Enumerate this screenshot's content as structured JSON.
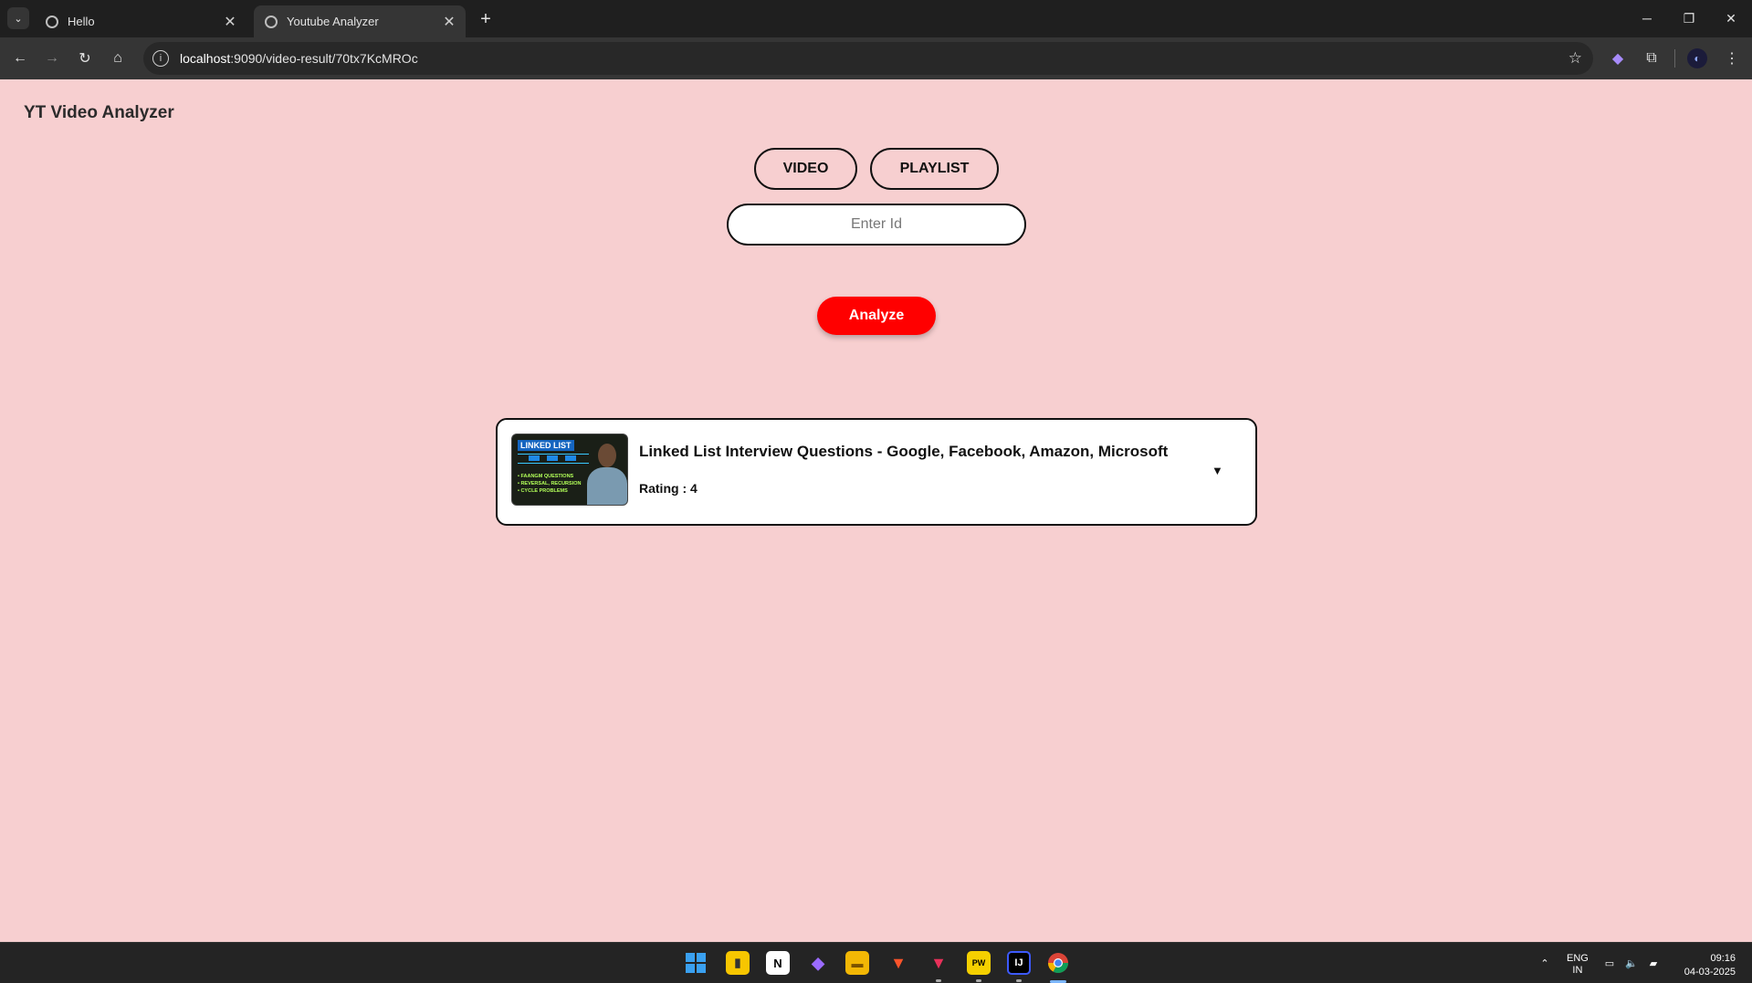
{
  "browser": {
    "tabs": [
      {
        "title": "Hello",
        "active": false
      },
      {
        "title": "Youtube Analyzer",
        "active": true
      }
    ],
    "url_host": "localhost",
    "url_rest": ":9090/video-result/70tx7KcMROc"
  },
  "app": {
    "title": "YT Video Analyzer",
    "mode_buttons": {
      "video": "VIDEO",
      "playlist": "PLAYLIST"
    },
    "id_input": {
      "value": "",
      "placeholder": "Enter Id"
    },
    "analyze_label": "Analyze"
  },
  "result": {
    "thumbnail": {
      "title": "LINKED LIST",
      "bullets": [
        "• FAANGM QUESTIONS",
        "• REVERSAL, RECURSION",
        "• CYCLE PROBLEMS"
      ]
    },
    "video_title": "Linked List Interview Questions - Google, Facebook, Amazon, Microsoft",
    "rating_text": "Rating : 4",
    "rating": 4,
    "expand_icon": "▼"
  },
  "taskbar": {
    "lang_line1": "ENG",
    "lang_line2": "IN",
    "time": "09:16",
    "date": "04-03-2025"
  },
  "colors": {
    "page_bg": "#f7cfd0",
    "accent": "#ff0000",
    "card_bg": "#ffffff"
  }
}
